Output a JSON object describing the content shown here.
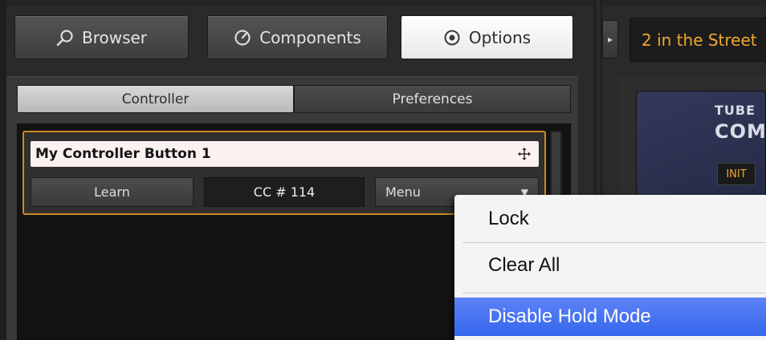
{
  "toolbar": {
    "browser_label": "Browser",
    "components_label": "Components",
    "options_label": "Options"
  },
  "preset": {
    "name": "2 in the Street"
  },
  "tabs": [
    {
      "label": "Controller",
      "active": true
    },
    {
      "label": "Preferences",
      "active": false
    }
  ],
  "mapping": {
    "name": "My Controller Button 1",
    "learn_label": "Learn",
    "cc_value": "CC # 114",
    "menu_label": "Menu"
  },
  "plugin": {
    "title_line1": "TUBE",
    "title_line2": "COM",
    "init_label": "INIT"
  },
  "context_menu": {
    "items": [
      {
        "label": "Lock",
        "highlighted": false
      },
      {
        "label": "Clear All",
        "highlighted": false
      },
      {
        "label": "Disable Hold Mode",
        "highlighted": true
      }
    ]
  },
  "colors": {
    "accent_orange": "#f0a830",
    "selection_border": "#d08a20",
    "menu_highlight": "#3a6cf0"
  },
  "icons": {
    "browser": "search-icon",
    "components": "gauge-icon",
    "options": "target-icon",
    "collapse": "chevron-right-icon",
    "mapping_move": "move-icon",
    "menu_dropdown": "triangle-down-icon"
  }
}
